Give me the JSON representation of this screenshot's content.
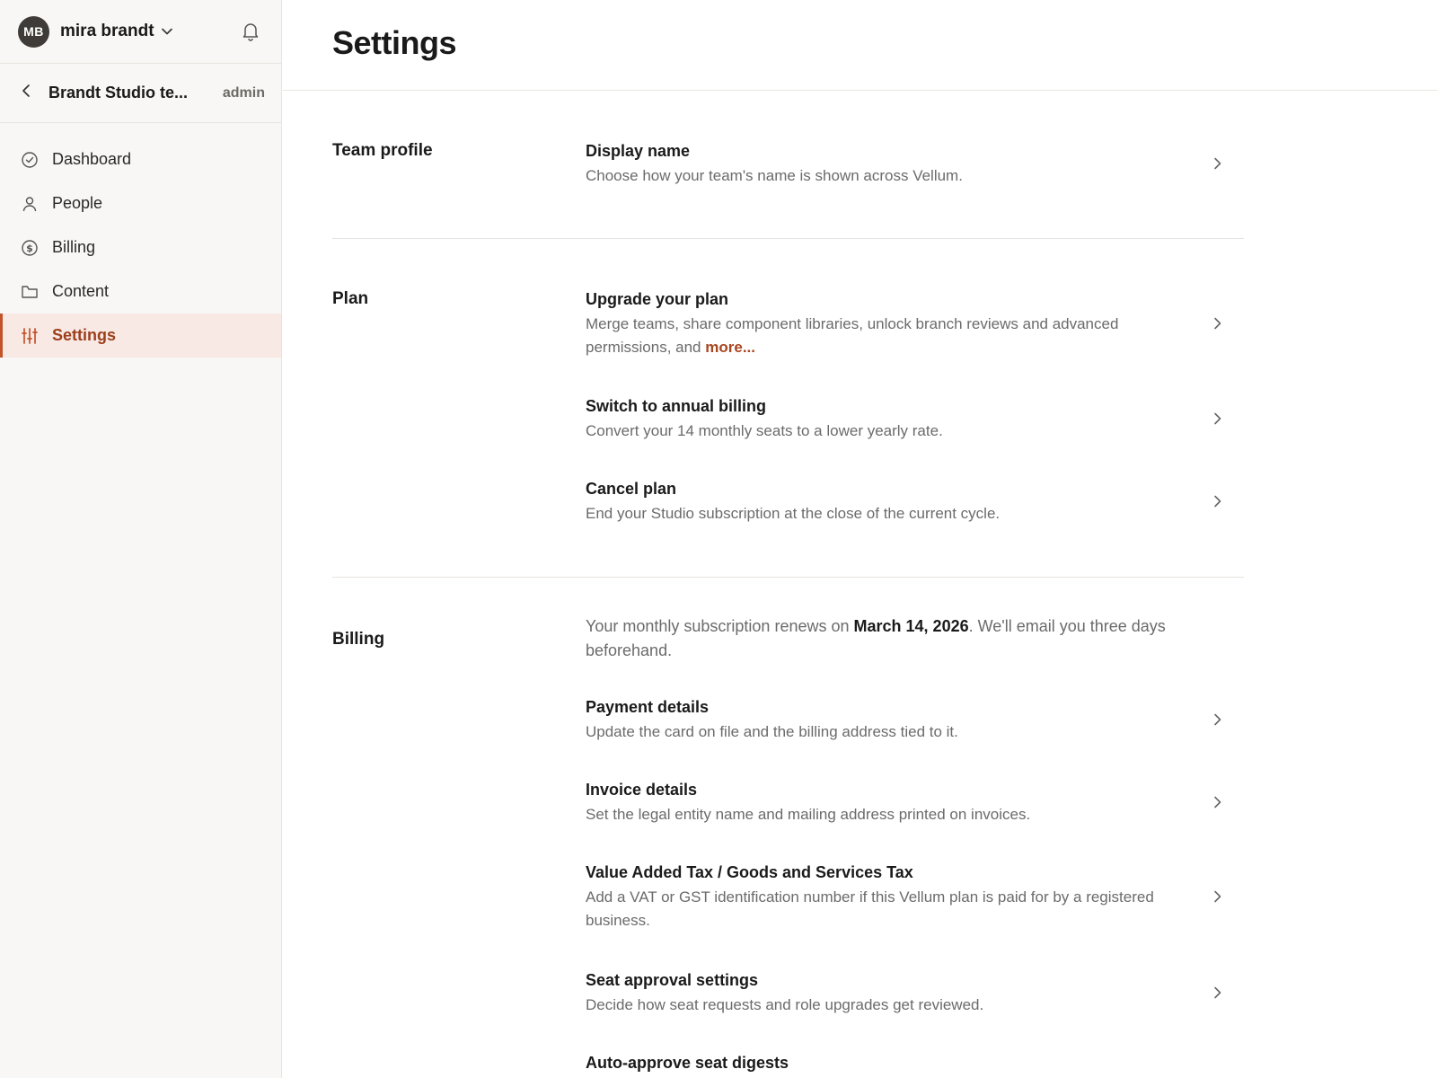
{
  "user": {
    "initials": "MB",
    "name": "mira brandt"
  },
  "team": {
    "name": "Brandt Studio te...",
    "role": "admin"
  },
  "nav": [
    {
      "label": "Dashboard",
      "icon": "check-circle-icon"
    },
    {
      "label": "People",
      "icon": "person-icon"
    },
    {
      "label": "Billing",
      "icon": "dollar-circle-icon"
    },
    {
      "label": "Content",
      "icon": "folder-icon"
    },
    {
      "label": "Settings",
      "icon": "sliders-icon",
      "active": true
    }
  ],
  "page": {
    "title": "Settings"
  },
  "sections": {
    "team_profile": {
      "label": "Team profile",
      "rows": [
        {
          "title": "Display name",
          "desc": "Choose how your team's name is shown across Vellum."
        }
      ]
    },
    "plan": {
      "label": "Plan",
      "rows": [
        {
          "title": "Upgrade your plan",
          "desc": "Merge teams, share component libraries, unlock branch reviews and advanced permissions, and",
          "more": "more..."
        },
        {
          "title": "Switch to annual billing",
          "desc": "Convert your 14 monthly seats to a lower yearly rate."
        },
        {
          "title": "Cancel plan",
          "desc": "End your Studio subscription at the close of the current cycle."
        }
      ]
    },
    "billing": {
      "label": "Billing",
      "notice": {
        "before": "Your monthly subscription renews on",
        "date": "March 14, 2026",
        "after": ". We'll email you three days beforehand."
      },
      "rows": [
        {
          "title": "Payment details",
          "desc": "Update the card on file and the billing address tied to it."
        },
        {
          "title": "Invoice details",
          "desc": "Set the legal entity name and mailing address printed on invoices."
        },
        {
          "title": "Value Added Tax / Goods and Services Tax",
          "desc": "Add a VAT or GST identification number if this Vellum plan is paid for by a registered business."
        },
        {
          "title": "Seat approval settings",
          "desc": "Decide how seat requests and role upgrades get reviewed."
        },
        {
          "title": "Auto-approve seat digests",
          "desc": ""
        }
      ]
    }
  },
  "colors": {
    "accent": "#c2532a",
    "active_bg": "#f8e9e4",
    "sidebar_bg": "#f8f7f5"
  }
}
